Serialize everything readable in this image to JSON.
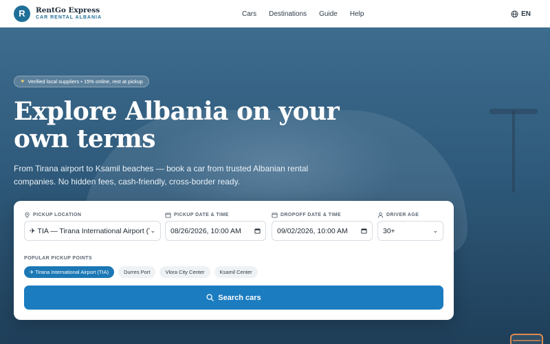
{
  "brand": {
    "name": "RentGo Express",
    "subtitle": "CAR RENTAL ALBANIA",
    "logo_letter": "R"
  },
  "nav": {
    "links": [
      "Cars",
      "Destinations",
      "Guide",
      "Help"
    ],
    "language": "EN"
  },
  "hero": {
    "badge": "Verified local suppliers • 15% online, rest at pickup",
    "headline": "Explore Albania on your own terms",
    "subheadline": "From Tirana airport to Ksamil beaches — book a car from trusted Albanian rental companies. No hidden fees, cash-friendly, cross-border ready."
  },
  "search": {
    "pickup_location": {
      "label": "PICKUP LOCATION",
      "value": "✈ TIA — Tirana International Airport (T"
    },
    "pickup_datetime": {
      "label": "PICKUP DATE & TIME",
      "value": "08/26/2026, 10:00 AM"
    },
    "dropoff_datetime": {
      "label": "DROPOFF DATE & TIME",
      "value": "09/02/2026, 10:00 AM"
    },
    "driver_age": {
      "label": "DRIVER AGE",
      "value": "30+"
    },
    "popular_label": "POPULAR PICKUP POINTS",
    "popular_points": [
      "✈ Tirana International Airport (TIA)",
      "Durres Port",
      "Vlora City Center",
      "Ksamil Center"
    ],
    "active_point_index": 0,
    "button_label": "Search cars"
  },
  "colors": {
    "primary": "#1b7cc0",
    "brand": "#1f6f98",
    "hero_overlay": "#2f5a7b"
  },
  "icons": [
    "globe-icon",
    "sparkle-icon",
    "location-pin-icon",
    "calendar-icon",
    "user-icon",
    "chevron-down-icon",
    "search-icon",
    "code-window-icon"
  ]
}
